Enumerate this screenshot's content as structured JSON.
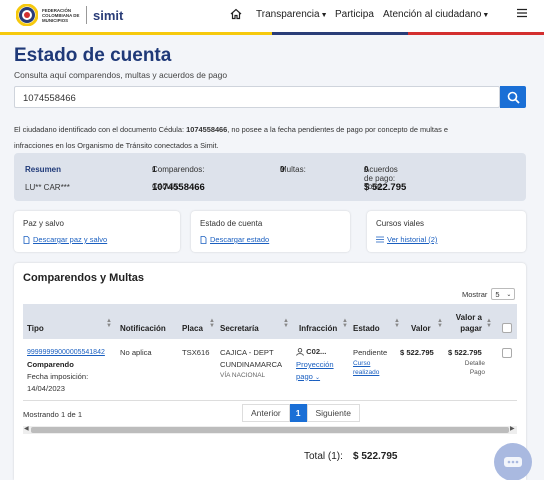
{
  "header": {
    "logo_text": "FEDERACIÓN COLOMBIANA DE MUNICIPIOS",
    "brand": "simit",
    "nav": [
      "Transparencia",
      "Participa",
      "Atención al ciudadano"
    ],
    "stripe_colors": [
      "#f6c90e",
      "#2a3d78",
      "#d32f2f"
    ]
  },
  "page": {
    "title": "Estado de cuenta",
    "subtitle": "Consulta aquí comparendos, multas y acuerdos de pago",
    "search_value": "1074558466",
    "info_prefix": "El ciudadano identificado con el documento Cédula:",
    "info_doc": "1074558466",
    "info_suffix": ", no posee a la fecha pendientes de pago por concepto de multas e",
    "info_line2": "infracciones en los Organismo de Tránsito conectados a Simit."
  },
  "summary": {
    "title": "Resumen",
    "name": "LU** CAR***",
    "comparendos_label": "Comparendos:",
    "comparendos": "1",
    "multas_label": "Multas:",
    "multas": "0",
    "acuerdos_label": "Acuerdos de pago:",
    "acuerdos": "0",
    "cedula_label": "Cédula:",
    "cedula": "1074558466",
    "total_label": "Total:",
    "total": "$ 522.795"
  },
  "cards": [
    {
      "title": "Paz y salvo",
      "link": "Descargar paz y salvo"
    },
    {
      "title": "Estado de cuenta",
      "link": "Descargar estado"
    },
    {
      "title": "Cursos viales",
      "link": "Ver historial (2)"
    }
  ],
  "table": {
    "title": "Comparendos y Multas",
    "mostrar_label": "Mostrar",
    "page_size": "5",
    "headers": {
      "tipo": "Tipo",
      "notificacion": "Notificación",
      "placa": "Placa",
      "secretaria": "Secretaría",
      "infraccion": "Infracción",
      "estado": "Estado",
      "valor": "Valor",
      "valor_pagar_1": "Valor a",
      "valor_pagar_2": "pagar"
    },
    "row": {
      "numero": "99999999000005541842",
      "tipo": "Comparendo",
      "fecha_label": "Fecha imposición:",
      "fecha": "14/04/2023",
      "notificacion": "No aplica",
      "placa": "TSX616",
      "secretaria_1": "CAJICA - DEPT",
      "secretaria_2": "CUNDINAMARCA",
      "secretaria_3": "VÍA NACIONAL",
      "infraccion": "C02...",
      "proyeccion_1": "Proyección",
      "proyeccion_2": "pago",
      "estado": "Pendiente",
      "curso_1": "Curso",
      "curso_2": "realizado",
      "valor": "$ 522.795",
      "valor_pagar": "$ 522.795",
      "detalle_1": "Detalle",
      "detalle_2": "Pago"
    },
    "showing": "Mostrando 1 de 1",
    "pagination": {
      "prev": "Anterior",
      "current": "1",
      "next": "Siguiente"
    },
    "total_label": "Total (1):",
    "total_value": "$ 522.795"
  }
}
